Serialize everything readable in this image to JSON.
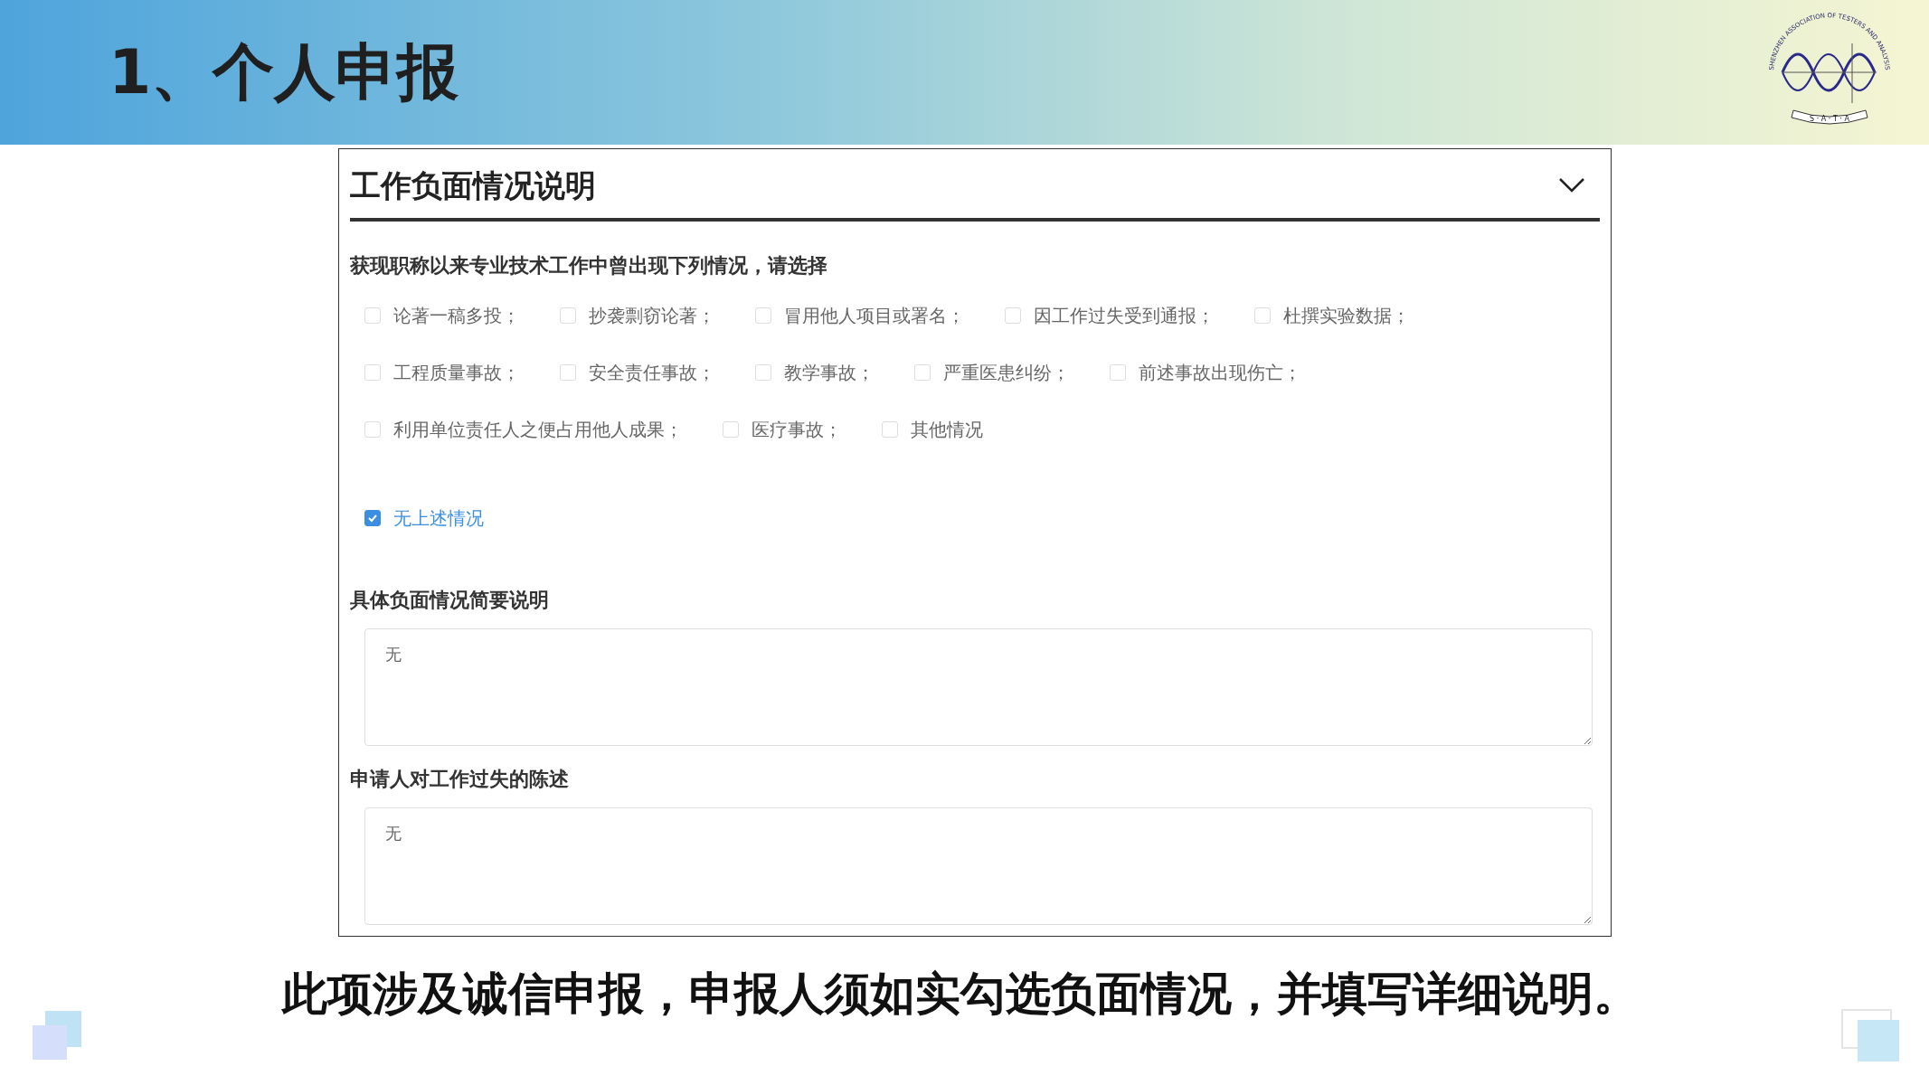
{
  "slide_title": "1、个人申报",
  "logo": {
    "ring_text": "SHENZHEN ASSOCIATION OF TESTERS AND ANALYSIS",
    "banner_text": "S · A · T · A"
  },
  "form": {
    "section_title": "工作负面情况说明",
    "expanded": true,
    "question": "获现职称以来专业技术工作中曾出现下列情况，请选择",
    "option_rows": [
      [
        {
          "label": "论著一稿多投；",
          "checked": false
        },
        {
          "label": "抄袭剽窃论著；",
          "checked": false
        },
        {
          "label": "冒用他人项目或署名；",
          "checked": false
        },
        {
          "label": "因工作过失受到通报；",
          "checked": false
        },
        {
          "label": "杜撰实验数据；",
          "checked": false
        }
      ],
      [
        {
          "label": "工程质量事故；",
          "checked": false
        },
        {
          "label": "安全责任事故；",
          "checked": false
        },
        {
          "label": "教学事故；",
          "checked": false
        },
        {
          "label": "严重医患纠纷；",
          "checked": false
        },
        {
          "label": "前述事故出现伤亡；",
          "checked": false
        }
      ],
      [
        {
          "label": "利用单位责任人之便占用他人成果；",
          "checked": false
        },
        {
          "label": "医疗事故；",
          "checked": false
        },
        {
          "label": "其他情况",
          "checked": false
        }
      ]
    ],
    "none_option": {
      "label": "无上述情况",
      "checked": true
    },
    "fields": [
      {
        "label": "具体负面情况简要说明",
        "value": "无"
      },
      {
        "label": "申请人对工作过失的陈述",
        "value": "无"
      }
    ]
  },
  "caption": "此项涉及诚信申报，申报人须如实勾选负面情况，并填写详细说明。"
}
